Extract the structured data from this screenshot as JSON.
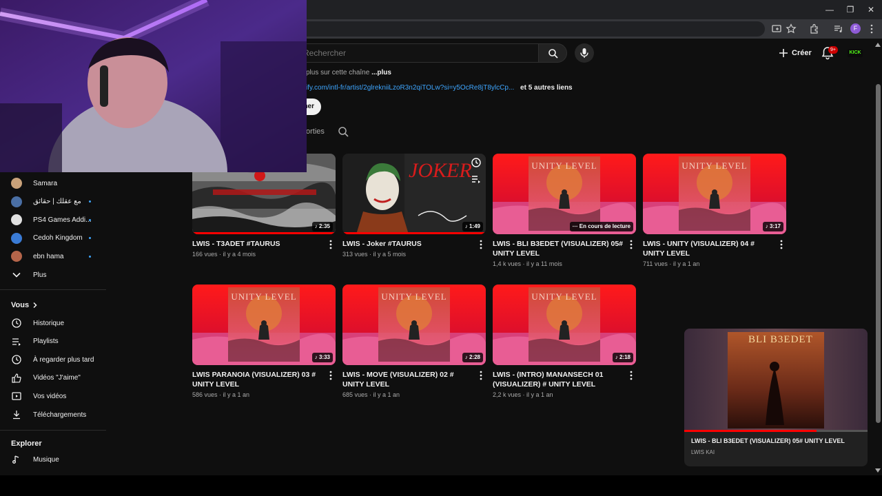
{
  "search": {
    "placeholder": "Rechercher"
  },
  "header": {
    "create_label": "Créer",
    "notifications_badge": "9+",
    "kick_label": "KICK",
    "profile_initial": "F"
  },
  "channel": {
    "description_snippet": "plus sur cette chaîne",
    "description_more": "...plus",
    "link_text": "ify.com/intl-fr/artist/2glrekniiLzoR3n2qiTOLw?si=y5OcRe8jT8ylcCp...",
    "other_links": "et 5 autres liens",
    "subscribe_fragment": "ner",
    "tab_fragment": "orties"
  },
  "sidebar": {
    "subscriptions": [
      {
        "name": "Samara",
        "color": "#c9a27a",
        "new": false
      },
      {
        "name": "مع عقلك | حقائق",
        "color": "#4a6fa5",
        "new": true
      },
      {
        "name": "PS4 Games Addi...",
        "color": "#e0e0e0",
        "new": true
      },
      {
        "name": "Cedoh Kingdom",
        "color": "#3a7bd5",
        "new": true
      },
      {
        "name": "ebn hama",
        "color": "#b5654a",
        "new": true
      }
    ],
    "more_label": "Plus",
    "you_section": "Vous",
    "you_items": [
      {
        "label": "Historique",
        "icon": "history-icon"
      },
      {
        "label": "Playlists",
        "icon": "playlists-icon"
      },
      {
        "label": "À regarder plus tard",
        "icon": "watch-later-icon"
      },
      {
        "label": "Vidéos \"J'aime\"",
        "icon": "like-icon"
      },
      {
        "label": "Vos vidéos",
        "icon": "your-videos-icon"
      },
      {
        "label": "Téléchargements",
        "icon": "downloads-icon"
      }
    ],
    "explore_section": "Explorer",
    "explore_items": [
      {
        "label": "Musique",
        "icon": "music-icon"
      }
    ]
  },
  "videos": [
    {
      "title": "LWIS - T3ADET #TAURUS",
      "views": "166 vues",
      "age": "il y a 4 mois",
      "duration": "2:35",
      "art": "waves",
      "playing": false
    },
    {
      "title": "LWIS - Joker #TAURUS",
      "views": "313 vues",
      "age": "il y a 5 mois",
      "duration": "1:49",
      "art": "joker",
      "playing": false
    },
    {
      "title": "LWIS - BLI B3EDET (VISUALIZER) 05# UNITY LEVEL",
      "views": "1,4 k vues",
      "age": "il y a 11 mois",
      "duration": "En cours de lecture",
      "art": "unity",
      "playing": true
    },
    {
      "title": "LWIS - UNITY (VISUALIZER) 04 # UNITY LEVEL",
      "views": "711 vues",
      "age": "il y a 1 an",
      "duration": "3:17",
      "art": "unity",
      "playing": false
    },
    {
      "title": "LWIS PARANOIA (VISUALIZER) 03 # UNITY LEVEL",
      "views": "586 vues",
      "age": "il y a 1 an",
      "duration": "3:33",
      "art": "unity",
      "playing": false
    },
    {
      "title": "LWIS  - MOVE (VISUALIZER) 02 # UNITY LEVEL",
      "views": "685 vues",
      "age": "il y a 1 an",
      "duration": "2:28",
      "art": "unity",
      "playing": false
    },
    {
      "title": "LWIS - (INTRO) MANANSECH 01 (VISUALIZER) # UNITY LEVEL",
      "views": "2,2 k vues",
      "age": "il y a 1 an",
      "duration": "2:18",
      "art": "unity",
      "playing": false
    }
  ],
  "thumb_text": {
    "unity": "UNITY LEVEL",
    "joker": "JOKER"
  },
  "miniplayer": {
    "title": "LWIS - BLI B3EDET (VISUALIZER) 05# UNITY LEVEL",
    "channel": "LWIS KAI",
    "cover_text": "BLI B3EDET",
    "progress": 0.72
  },
  "colors": {
    "accent_red": "#ff0000",
    "link_blue": "#3ea6ff",
    "background": "#0f0f0f"
  }
}
